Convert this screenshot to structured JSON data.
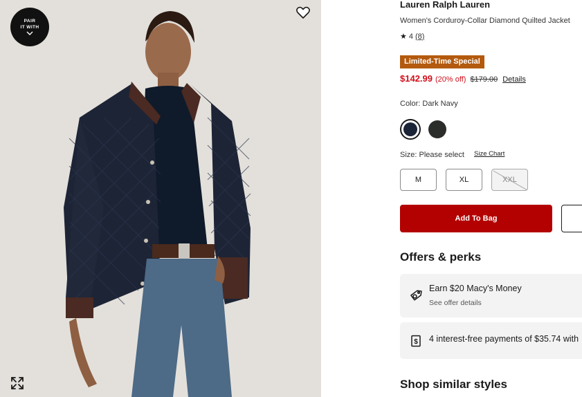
{
  "image_panel": {
    "pair_badge_text": "PAIR\nIT WITH",
    "favorite_icon": "heart-outline-icon",
    "expand_icon": "expand-arrows-icon"
  },
  "product": {
    "brand": "Lauren Ralph Lauren",
    "name": "Women's Corduroy-Collar Diamond Quilted Jacket",
    "rating": {
      "value": "4",
      "count": "(8)",
      "stars_out_of_5": 4
    },
    "promo_badge": "Limited-Time Special",
    "price": {
      "sale": "$142.99",
      "percent_off": "(20% off)",
      "original": "$179.00",
      "details_link": "Details"
    }
  },
  "color": {
    "label": "Color: Dark Navy",
    "swatches": [
      {
        "name": "Dark Navy",
        "hex": "#1c2438",
        "selected": true
      },
      {
        "name": "Charcoal",
        "hex": "#2b2d2a",
        "selected": false
      }
    ]
  },
  "size": {
    "label": "Size: Please select",
    "chart_link": "Size Chart",
    "options": [
      {
        "label": "M",
        "available": true
      },
      {
        "label": "XL",
        "available": true
      },
      {
        "label": "XXL",
        "available": false
      }
    ]
  },
  "actions": {
    "add_to_bag": "Add To Bag"
  },
  "offers": {
    "heading": "Offers & perks",
    "items": [
      {
        "icon": "tag-dollar-icon",
        "title": "Earn $20 Macy's Money",
        "subtitle": "See offer details"
      },
      {
        "icon": "dollar-receipt-icon",
        "title": "4 interest-free payments of $35.74 with"
      }
    ]
  },
  "similar": {
    "heading": "Shop similar styles"
  },
  "colors": {
    "sale_red": "#d0101b",
    "add_to_bag_bg": "#b30000",
    "promo_badge_bg": "#b35a0f"
  }
}
